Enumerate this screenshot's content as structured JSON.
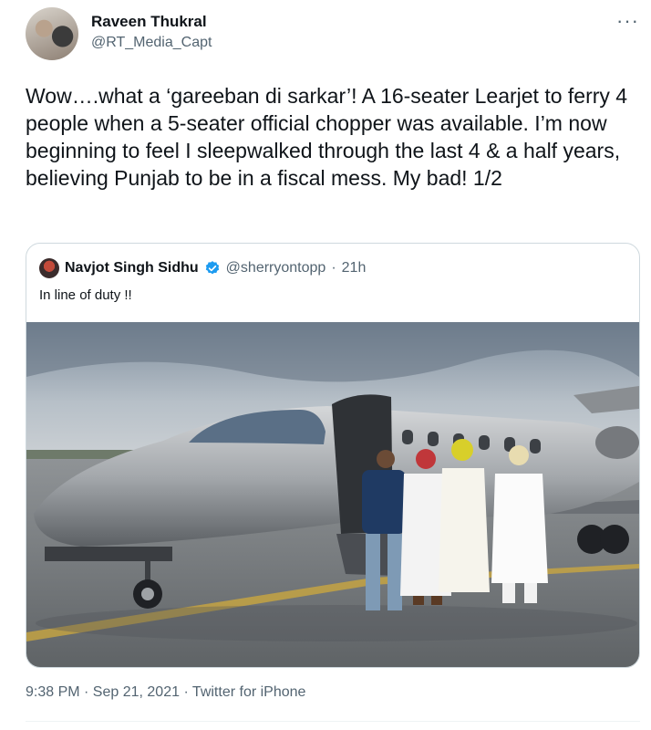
{
  "author": {
    "name": "Raveen Thukral",
    "handle": "@RT_Media_Capt"
  },
  "more_icon": "more-horizontal-icon",
  "tweet_text": "Wow….what a ‘gareeban di sarkar’! A 16-seater Learjet to ferry 4 people when a 5-seater official chopper was available. I’m now beginning to feel I sleepwalked through the last 4 & a half years, believing Punjab to be in a fiscal mess. My bad! 1/2",
  "quoted_tweet": {
    "name": "Navjot Singh Sidhu",
    "verified": true,
    "handle": "@sherryontopp",
    "separator": "·",
    "time": "21h",
    "text": "In line of duty !!"
  },
  "footer": {
    "timestamp": "9:38 PM · Sep 21, 2021 · Twitter for iPhone"
  },
  "colors": {
    "text": "#0f1419",
    "muted": "#536471",
    "verified": "#1d9bf0",
    "border": "#cfd9de"
  }
}
